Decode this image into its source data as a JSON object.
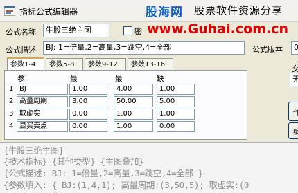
{
  "window": {
    "title": "指标公式编辑器"
  },
  "banner": {
    "logo": "股海网",
    "slogan": "股票软件资源分享",
    "watermark": "www.Guhai.com.cn"
  },
  "form": {
    "name_label": "公式名称",
    "name_value": "牛股三绝主图",
    "password_label": "密",
    "desc_label": "公式描述",
    "desc_value": "BJ: 1=倍量,2=高量,3=跳空,4=全部",
    "version_label": "公式版本",
    "version_value": "0"
  },
  "tabs": [
    "参数1-4",
    "参数5-8",
    "参数9-12",
    "参数13-16"
  ],
  "params": {
    "headers": [
      "参数",
      "最小",
      "最大",
      "缺省"
    ],
    "rows": [
      {
        "num": "1",
        "name": "BJ",
        "min": "1.00",
        "max": "4.00",
        "def": "1.00"
      },
      {
        "num": "2",
        "name": "高量周期",
        "min": "3.00",
        "max": "50.00",
        "def": "5.00"
      },
      {
        "num": "3",
        "name": "取虚实",
        "min": "0.00",
        "max": "1.00",
        "def": "1.00"
      },
      {
        "num": "4",
        "name": "显买卖点",
        "min": "0.00",
        "max": "1.00",
        "def": "0.00"
      }
    ]
  },
  "right_panel": {
    "cross_label": "交",
    "input_value": "无",
    "btn1_label": "作",
    "btn2_label": "编"
  },
  "editor": {
    "lines": [
      "{牛股三绝主图}",
      "{技术指标} {其他类型} {主图叠加}",
      "{公式描述: BJ: 1=倍量,2=高量,3=跳空,4=全部 }",
      "{参数填入: { BJ:(1,4,1); 高量周期:(3,50,5); 取虚实:(0"
    ]
  }
}
